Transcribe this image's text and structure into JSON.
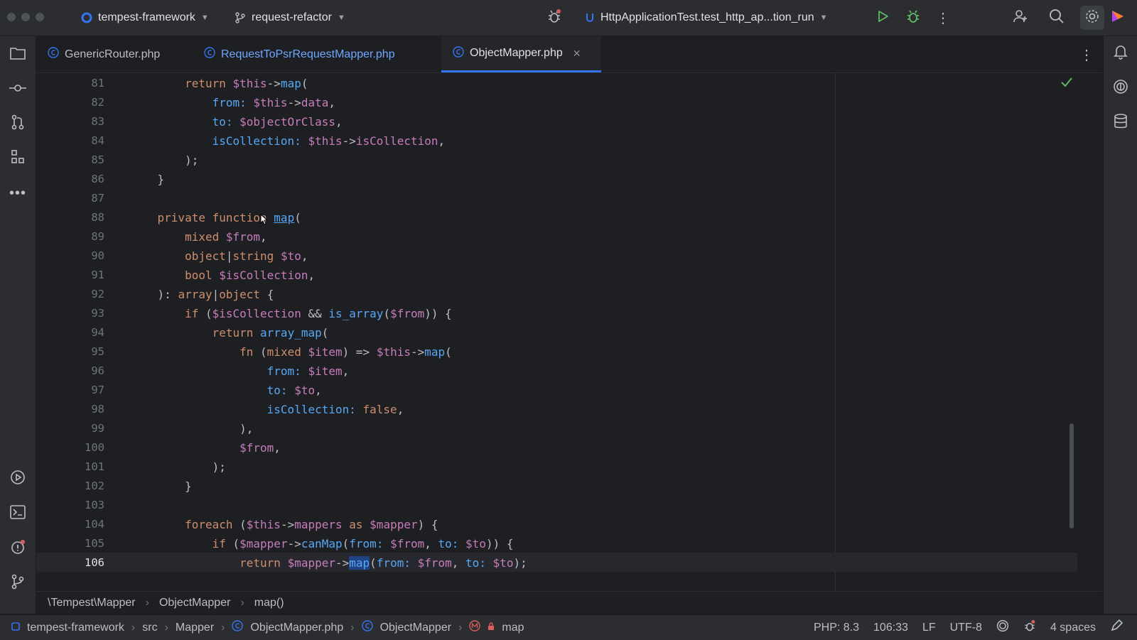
{
  "titlebar": {
    "project": "tempest-framework",
    "branch": "request-refactor",
    "run_config": "HttpApplicationTest.test_http_ap...tion_run"
  },
  "tabs": [
    {
      "label": "GenericRouter.php",
      "active": false
    },
    {
      "label": "RequestToPsrRequestMapper.php",
      "active": false
    },
    {
      "label": "ObjectMapper.php",
      "active": true
    }
  ],
  "editor": {
    "current_line": 106,
    "lines": [
      {
        "n": "81"
      },
      {
        "n": "82"
      },
      {
        "n": "83"
      },
      {
        "n": "84"
      },
      {
        "n": "85"
      },
      {
        "n": "86"
      },
      {
        "n": "87"
      },
      {
        "n": "88"
      },
      {
        "n": "89"
      },
      {
        "n": "90"
      },
      {
        "n": "91"
      },
      {
        "n": "92"
      },
      {
        "n": "93"
      },
      {
        "n": "94"
      },
      {
        "n": "95"
      },
      {
        "n": "96"
      },
      {
        "n": "97"
      },
      {
        "n": "98"
      },
      {
        "n": "99"
      },
      {
        "n": "100"
      },
      {
        "n": "101"
      },
      {
        "n": "102"
      },
      {
        "n": "103"
      },
      {
        "n": "104"
      },
      {
        "n": "105"
      },
      {
        "n": "106"
      }
    ],
    "code": {
      "l81": [
        [
          "",
          "        "
        ],
        [
          "kw",
          "return "
        ],
        [
          "var",
          "$this"
        ],
        [
          "plain",
          "->"
        ],
        [
          "fn",
          "map"
        ],
        [
          "plain",
          "("
        ]
      ],
      "l82": [
        [
          "",
          "            "
        ],
        [
          "named",
          "from: "
        ],
        [
          "var",
          "$this"
        ],
        [
          "plain",
          "->"
        ],
        [
          "prop",
          "data"
        ],
        [
          "plain",
          ","
        ]
      ],
      "l83": [
        [
          "",
          "            "
        ],
        [
          "named",
          "to: "
        ],
        [
          "var",
          "$objectOrClass"
        ],
        [
          "plain",
          ","
        ]
      ],
      "l84": [
        [
          "",
          "            "
        ],
        [
          "named",
          "isCollection: "
        ],
        [
          "var",
          "$this"
        ],
        [
          "plain",
          "->"
        ],
        [
          "prop",
          "isCollection"
        ],
        [
          "plain",
          ","
        ]
      ],
      "l85": [
        [
          "",
          "        "
        ],
        [
          "plain",
          ");"
        ]
      ],
      "l86": [
        [
          "",
          "    "
        ],
        [
          "plain",
          "}"
        ]
      ],
      "l87": [],
      "l88": [
        [
          "",
          "    "
        ],
        [
          "kw",
          "private function "
        ],
        [
          "fnu",
          "map"
        ],
        [
          "plain",
          "("
        ]
      ],
      "l89": [
        [
          "",
          "        "
        ],
        [
          "kw",
          "mixed "
        ],
        [
          "var",
          "$from"
        ],
        [
          "plain",
          ","
        ]
      ],
      "l90": [
        [
          "",
          "        "
        ],
        [
          "kw",
          "object"
        ],
        [
          "plain",
          "|"
        ],
        [
          "kw",
          "string "
        ],
        [
          "var",
          "$to"
        ],
        [
          "plain",
          ","
        ]
      ],
      "l91": [
        [
          "",
          "        "
        ],
        [
          "kw",
          "bool "
        ],
        [
          "var",
          "$isCollection"
        ],
        [
          "plain",
          ","
        ]
      ],
      "l92": [
        [
          "",
          "    "
        ],
        [
          "plain",
          "): "
        ],
        [
          "kw",
          "array"
        ],
        [
          "plain",
          "|"
        ],
        [
          "kw",
          "object "
        ],
        [
          "plain",
          "{"
        ]
      ],
      "l93": [
        [
          "",
          "        "
        ],
        [
          "kw",
          "if "
        ],
        [
          "plain",
          "("
        ],
        [
          "var",
          "$isCollection"
        ],
        [
          "plain",
          " && "
        ],
        [
          "fn",
          "is_array"
        ],
        [
          "plain",
          "("
        ],
        [
          "var",
          "$from"
        ],
        [
          "plain",
          ")) {"
        ]
      ],
      "l94": [
        [
          "",
          "            "
        ],
        [
          "kw",
          "return "
        ],
        [
          "fn",
          "array_map"
        ],
        [
          "plain",
          "("
        ]
      ],
      "l95": [
        [
          "",
          "                "
        ],
        [
          "kw",
          "fn "
        ],
        [
          "plain",
          "("
        ],
        [
          "kw",
          "mixed "
        ],
        [
          "var",
          "$item"
        ],
        [
          "plain",
          ") => "
        ],
        [
          "var",
          "$this"
        ],
        [
          "plain",
          "->"
        ],
        [
          "fn",
          "map"
        ],
        [
          "plain",
          "("
        ]
      ],
      "l96": [
        [
          "",
          "                    "
        ],
        [
          "named",
          "from: "
        ],
        [
          "var",
          "$item"
        ],
        [
          "plain",
          ","
        ]
      ],
      "l97": [
        [
          "",
          "                    "
        ],
        [
          "named",
          "to: "
        ],
        [
          "var",
          "$to"
        ],
        [
          "plain",
          ","
        ]
      ],
      "l98": [
        [
          "",
          "                    "
        ],
        [
          "named",
          "isCollection: "
        ],
        [
          "kw",
          "false"
        ],
        [
          "plain",
          ","
        ]
      ],
      "l99": [
        [
          "",
          "                "
        ],
        [
          "plain",
          "),"
        ]
      ],
      "l100": [
        [
          "",
          "                "
        ],
        [
          "var",
          "$from"
        ],
        [
          "plain",
          ","
        ]
      ],
      "l101": [
        [
          "",
          "            "
        ],
        [
          "plain",
          ");"
        ]
      ],
      "l102": [
        [
          "",
          "        "
        ],
        [
          "plain",
          "}"
        ]
      ],
      "l103": [],
      "l104": [
        [
          "",
          "        "
        ],
        [
          "kw",
          "foreach "
        ],
        [
          "plain",
          "("
        ],
        [
          "var",
          "$this"
        ],
        [
          "plain",
          "->"
        ],
        [
          "prop",
          "mappers "
        ],
        [
          "kw",
          "as "
        ],
        [
          "var",
          "$mapper"
        ],
        [
          "plain",
          ") {"
        ]
      ],
      "l105": [
        [
          "",
          "            "
        ],
        [
          "kw",
          "if "
        ],
        [
          "plain",
          "("
        ],
        [
          "var",
          "$mapper"
        ],
        [
          "plain",
          "->"
        ],
        [
          "fn",
          "canMap"
        ],
        [
          "plain",
          "("
        ],
        [
          "named",
          "from: "
        ],
        [
          "var",
          "$from"
        ],
        [
          "plain",
          ", "
        ],
        [
          "named",
          "to: "
        ],
        [
          "var",
          "$to"
        ],
        [
          "plain",
          ")) {"
        ]
      ],
      "l106": [
        [
          "",
          "                "
        ],
        [
          "kw",
          "return "
        ],
        [
          "var",
          "$mapper"
        ],
        [
          "plain",
          "->"
        ],
        [
          "fnhl",
          "map"
        ],
        [
          "plain",
          "("
        ],
        [
          "named",
          "from: "
        ],
        [
          "var",
          "$from"
        ],
        [
          "plain",
          ", "
        ],
        [
          "named",
          "to: "
        ],
        [
          "var",
          "$to"
        ],
        [
          "plain",
          ");"
        ]
      ]
    }
  },
  "breadcrumb": {
    "namespace": "\\Tempest\\Mapper",
    "class": "ObjectMapper",
    "method": "map()"
  },
  "statusbar": {
    "path": [
      "tempest-framework",
      "src",
      "Mapper",
      "ObjectMapper.php",
      "ObjectMapper",
      "map"
    ],
    "php_version": "PHP: 8.3",
    "position": "106:33",
    "line_ending": "LF",
    "encoding": "UTF-8",
    "indent": "4 spaces"
  },
  "colors": {
    "accent": "#3574f0",
    "keyword": "#cf8e6d",
    "variable": "#c77dbb",
    "function": "#56a8f5",
    "run_green": "#5fb865"
  }
}
